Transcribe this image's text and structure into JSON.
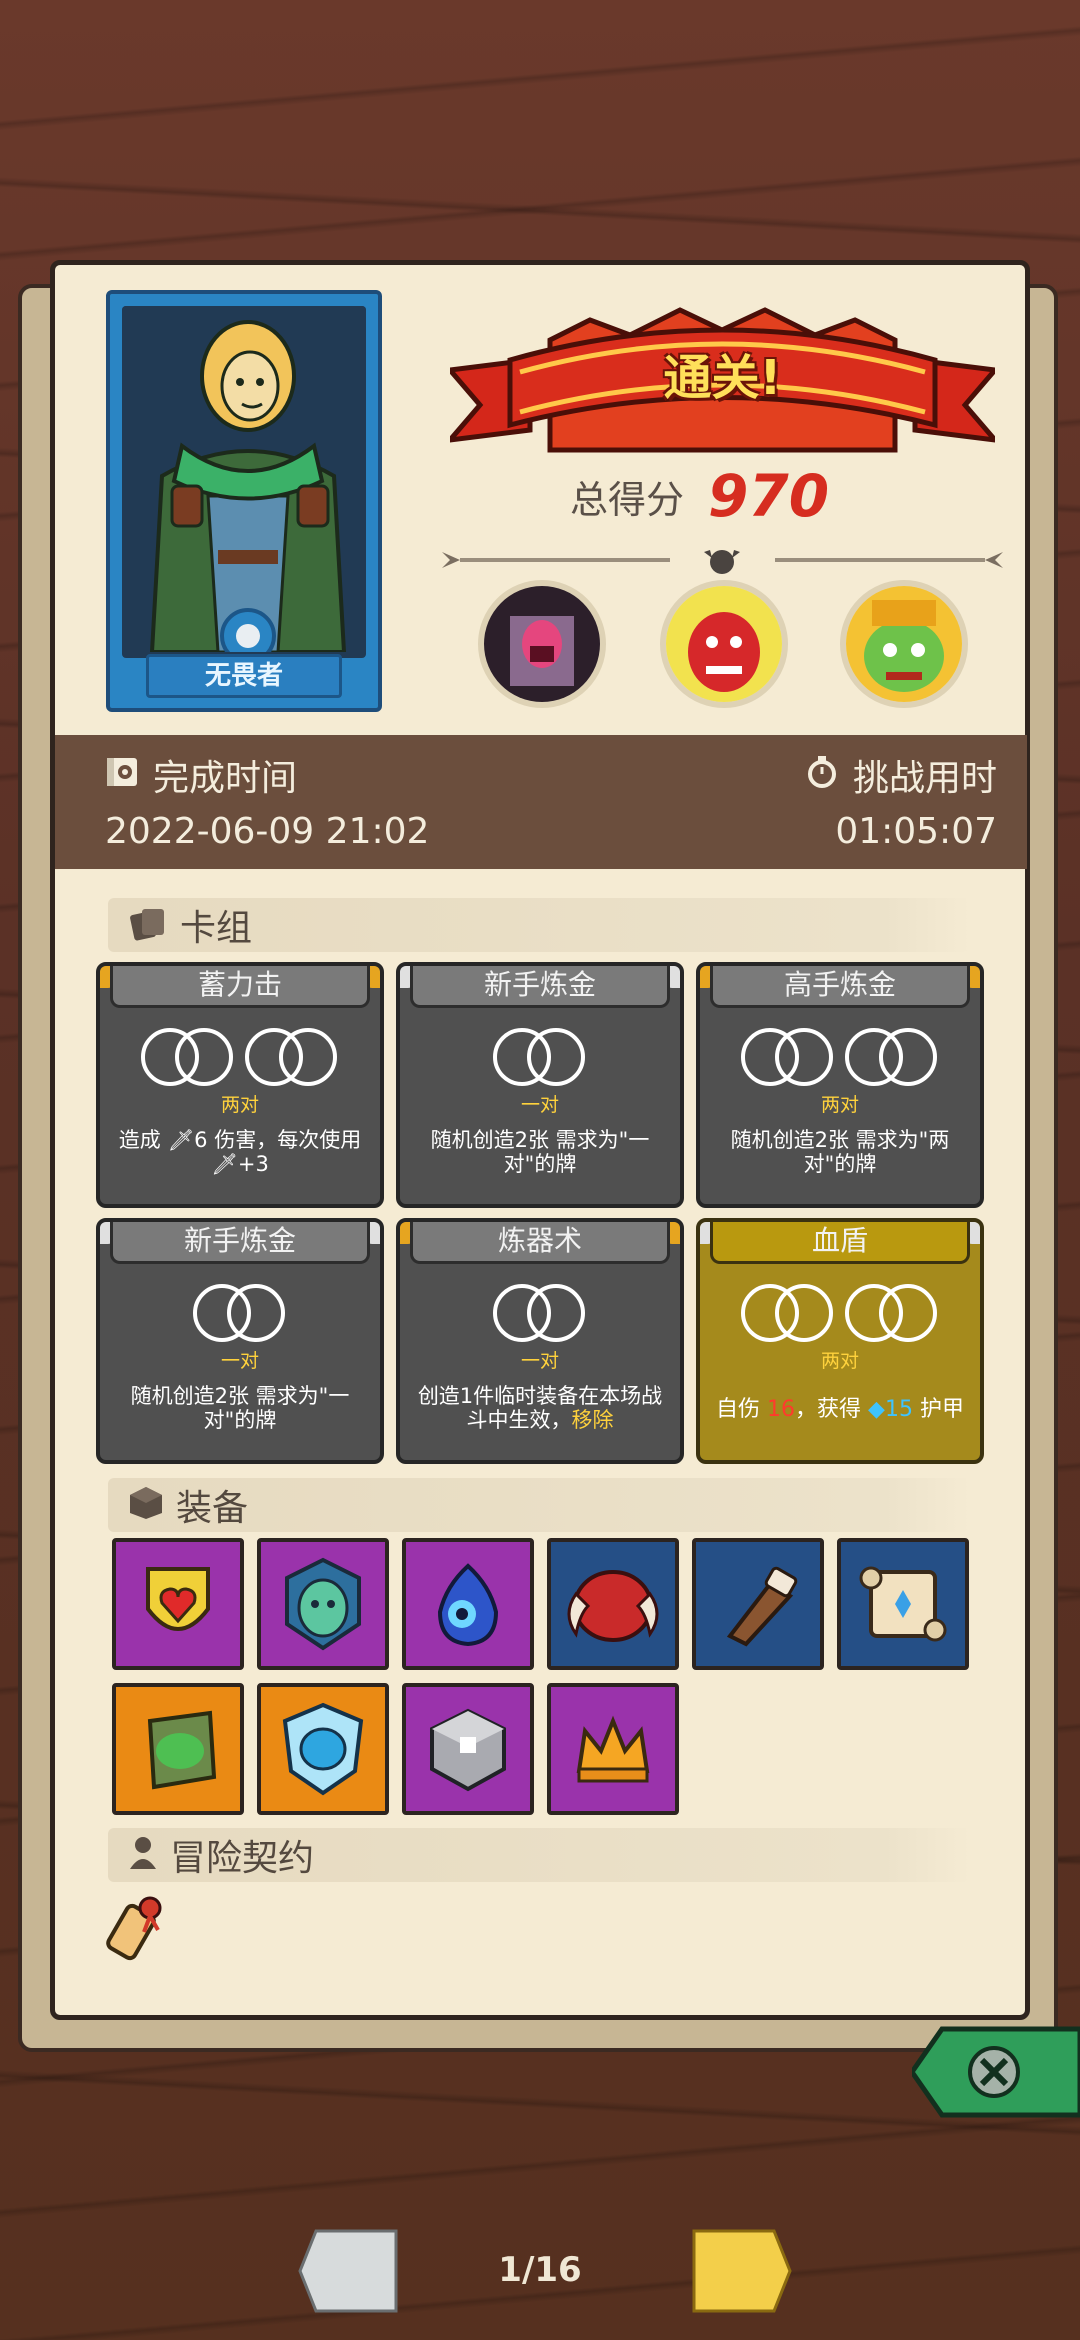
{
  "hero": {
    "name": "无畏者"
  },
  "result": {
    "banner": "通关!",
    "score_label": "总得分",
    "score_value": "970"
  },
  "info": {
    "finish_label": "完成时间",
    "finish_value": "2022-06-09 21:02",
    "duration_label": "挑战用时",
    "duration_value": "01:05:07"
  },
  "deck": {
    "title": "卡组",
    "cards": [
      {
        "name": "蓄力击",
        "req": "两对",
        "desc_pre": "造成 ",
        "desc_mid": "6 伤害，每次使用 ",
        "desc_post": "+3"
      },
      {
        "name": "新手炼金",
        "req": "一对",
        "desc": "随机创造2张 需求为\"一对\"的牌"
      },
      {
        "name": "高手炼金",
        "req": "两对",
        "desc": "随机创造2张 需求为\"两对\"的牌"
      },
      {
        "name": "新手炼金",
        "req": "一对",
        "desc": "随机创造2张 需求为\"一对\"的牌"
      },
      {
        "name": "炼器术",
        "req": "一对",
        "desc": "创造1件临时装备在本场战斗中生效，",
        "desc_hl": "移除"
      },
      {
        "name": "血盾",
        "req": "两对",
        "desc_a": "自伤 ",
        "desc_red": "16",
        "desc_b": "，获得 ",
        "desc_blue": "15",
        "desc_c": " 护甲"
      }
    ]
  },
  "equipment": {
    "title": "装备",
    "items": [
      {
        "icon": "heart-shield-icon",
        "rarity": "purple"
      },
      {
        "icon": "jade-mask-icon",
        "rarity": "purple"
      },
      {
        "icon": "blue-flame-eye-icon",
        "rarity": "purple"
      },
      {
        "icon": "horned-blob-icon",
        "rarity": "blue"
      },
      {
        "icon": "horn-icon",
        "rarity": "blue"
      },
      {
        "icon": "scroll-icon",
        "rarity": "blue"
      },
      {
        "icon": "mossy-book-icon",
        "rarity": "orange"
      },
      {
        "icon": "ice-pumpkin-badge-icon",
        "rarity": "orange"
      },
      {
        "icon": "stone-cube-icon",
        "rarity": "purple"
      },
      {
        "icon": "crown-icon",
        "rarity": "purple"
      }
    ]
  },
  "contract": {
    "title": "冒险契约",
    "item_icon": "scroll-contract-icon"
  },
  "pager": {
    "label": "1/16"
  },
  "colors": {
    "banner_red": "#d62d20",
    "gold": "#ffd23c",
    "parchment": "#f5ebd3"
  }
}
